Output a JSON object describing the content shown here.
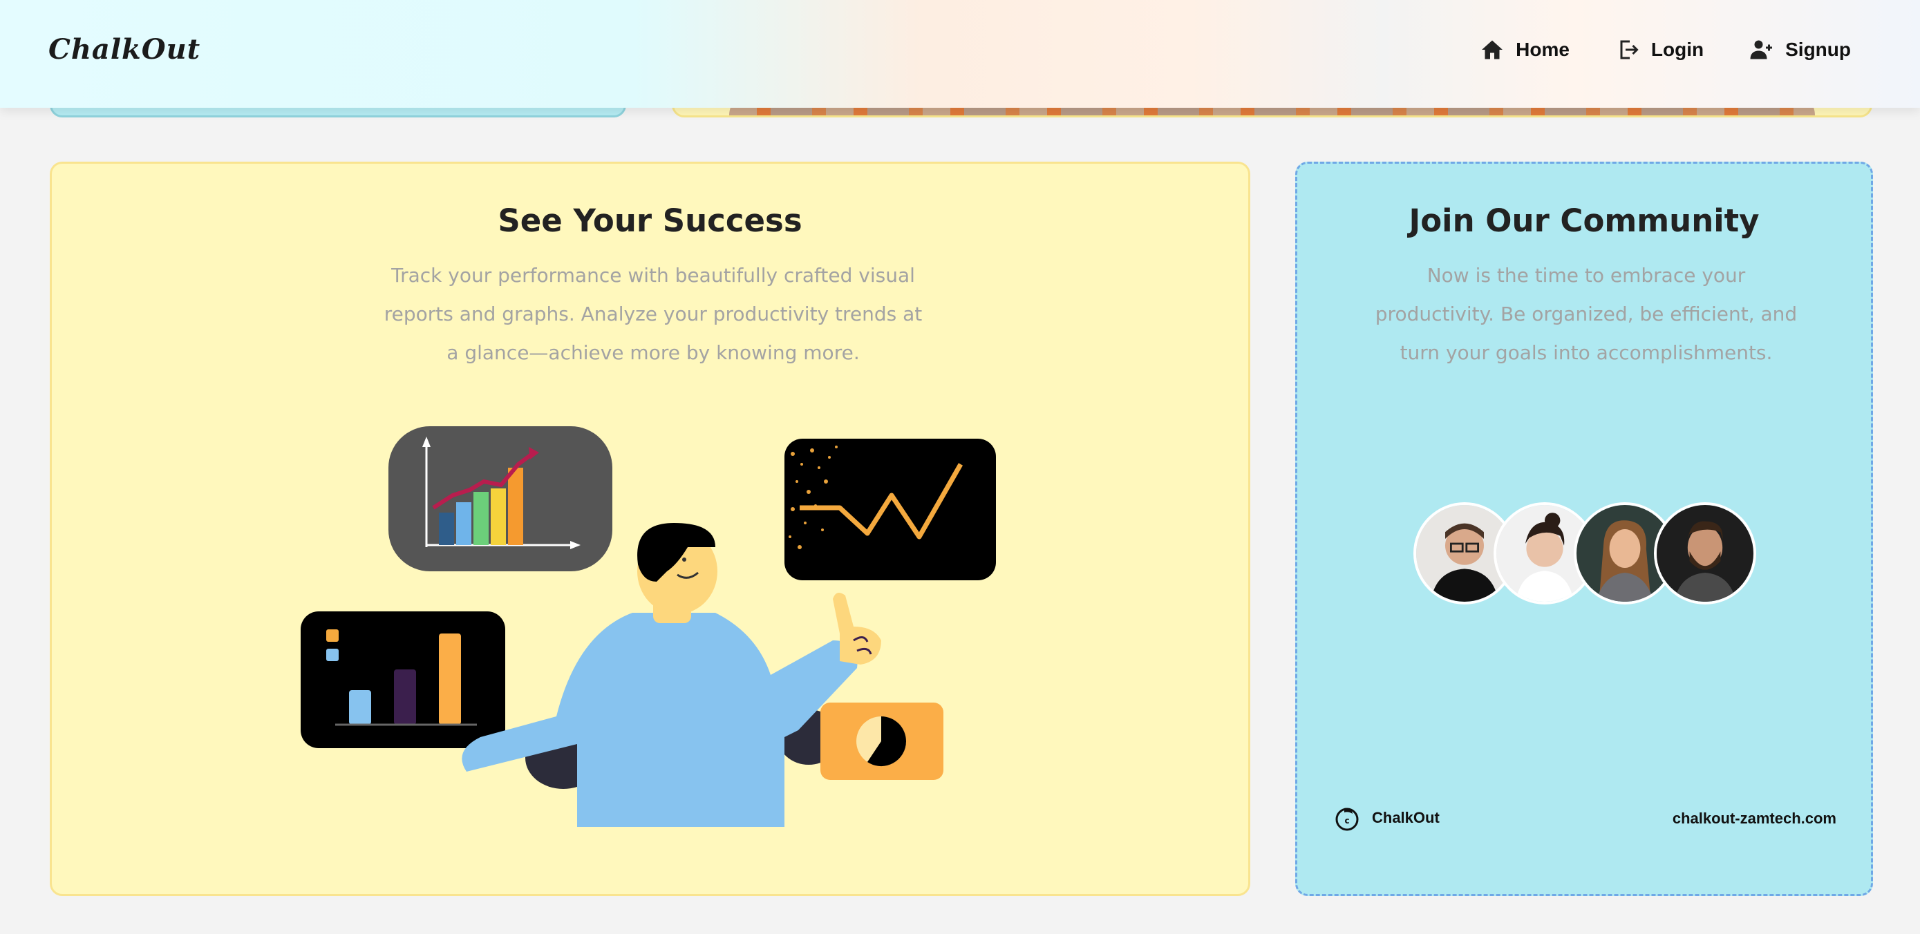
{
  "header": {
    "brand": "ChalkOut",
    "nav": [
      {
        "label": "Home",
        "icon": "home-icon"
      },
      {
        "label": "Login",
        "icon": "login-icon"
      },
      {
        "label": "Signup",
        "icon": "user-plus-icon"
      }
    ]
  },
  "success_card": {
    "title": "See Your Success",
    "description": "Track your performance with beautifully crafted visual reports and graphs. Analyze your productivity trends at a glance—achieve more by knowing more.",
    "illustration": "person-pointing-at-charts-illustration"
  },
  "community_card": {
    "title": "Join Our Community",
    "description": "Now is the time to embrace your productivity. Be organized, be efficient, and turn your goals into accomplishments.",
    "avatars": [
      {
        "name": "avatar-man-glasses"
      },
      {
        "name": "avatar-woman-smiling"
      },
      {
        "name": "avatar-woman-long-hair"
      },
      {
        "name": "avatar-man-beard"
      }
    ],
    "footer_brand": "ChalkOut",
    "footer_url": "chalkout-zamtech.com"
  },
  "colors": {
    "success_bg": "#fff8bd",
    "community_bg": "#afe9f1",
    "accent_orange": "#fbae48",
    "accent_blue": "#87c3ef"
  }
}
